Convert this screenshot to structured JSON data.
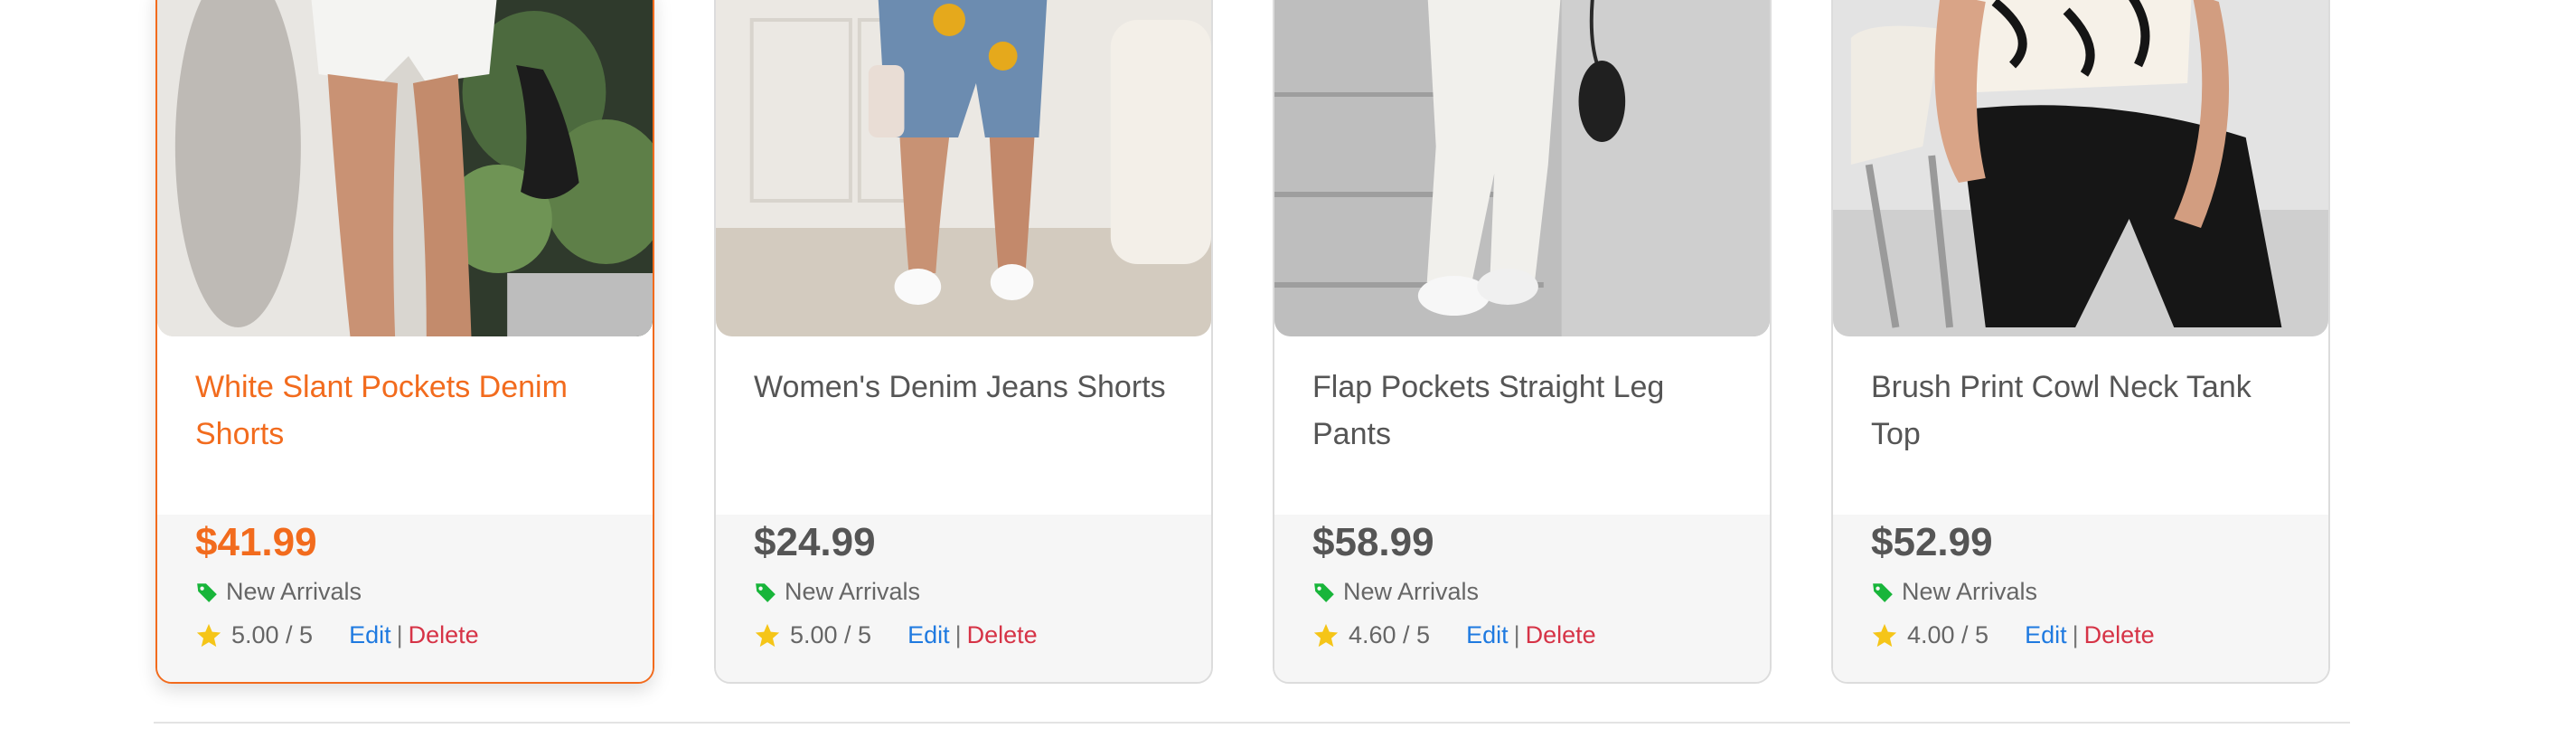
{
  "products": [
    {
      "title": "White Slant Pockets Denim Shorts",
      "price": "$41.99",
      "category": "New Arrivals",
      "rating": "5.00 / 5",
      "edit_label": "Edit",
      "sep": "|",
      "delete_label": "Delete"
    },
    {
      "title": "Women's Denim Jeans Shorts",
      "price": "$24.99",
      "category": "New Arrivals",
      "rating": "5.00 / 5",
      "edit_label": "Edit",
      "sep": "|",
      "delete_label": "Delete"
    },
    {
      "title": "Flap Pockets Straight Leg Pants",
      "price": "$58.99",
      "category": "New Arrivals",
      "rating": "4.60 / 5",
      "edit_label": "Edit",
      "sep": "|",
      "delete_label": "Delete"
    },
    {
      "title": "Brush Print Cowl Neck Tank Top",
      "price": "$52.99",
      "category": "New Arrivals",
      "rating": "4.00 / 5",
      "edit_label": "Edit",
      "sep": "|",
      "delete_label": "Delete"
    }
  ],
  "colors": {
    "accent": "#f26b1d",
    "tag_green": "#18b53a",
    "star_yellow": "#f5c518",
    "edit_blue": "#1f7ae0",
    "delete_red": "#d63346"
  },
  "icons": {
    "category": "tag-icon",
    "rating": "star-icon"
  }
}
